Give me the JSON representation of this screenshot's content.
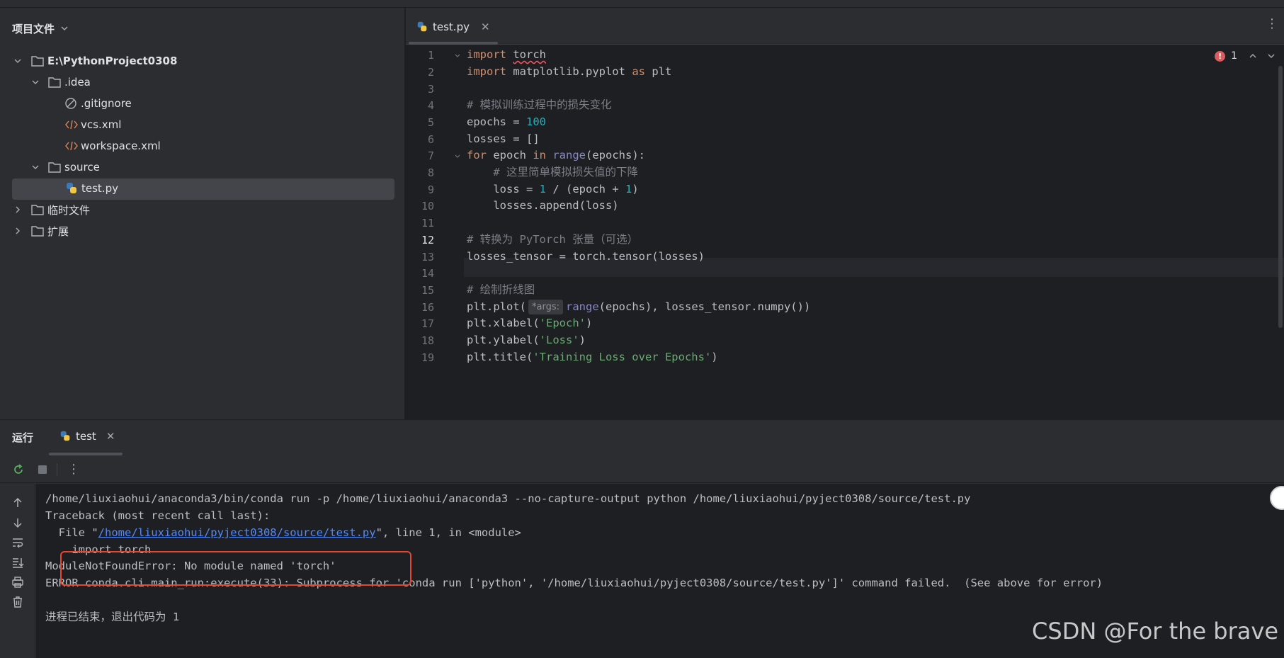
{
  "project": {
    "header": "项目文件",
    "items": [
      {
        "label": "E:\\PythonProject0308",
        "bold": true
      },
      {
        "label": ".idea"
      },
      {
        "label": ".gitignore"
      },
      {
        "label": "vcs.xml"
      },
      {
        "label": "workspace.xml"
      },
      {
        "label": "source"
      },
      {
        "label": "test.py"
      },
      {
        "label": "临时文件"
      },
      {
        "label": "扩展"
      }
    ]
  },
  "editor": {
    "tab_label": "test.py",
    "tab_close": "✕",
    "current_line": 12,
    "error_count": "1",
    "error_badge": "!",
    "line_numbers": [
      "1",
      "2",
      "3",
      "4",
      "5",
      "6",
      "7",
      "8",
      "9",
      "10",
      "11",
      "12",
      "13",
      "14",
      "15",
      "16",
      "17",
      "18",
      "19"
    ],
    "code": {
      "l1_kw": "import",
      "l1_rest": "torch",
      "l2_kw": "import",
      "l2_mod": " matplotlib.pyplot ",
      "l2_as": "as",
      "l2_alias": " plt",
      "l4": "# 模拟训练过程中的损失变化",
      "l5_a": "epochs = ",
      "l5_num": "100",
      "l6": "losses = []",
      "l7_for": "for",
      "l7_a": " epoch ",
      "l7_in": "in",
      "l7_range": " range",
      "l7_b": "(epochs):",
      "l8": "    # 这里简单模拟损失值的下降",
      "l9_a": "    loss = ",
      "l9_n1": "1",
      "l9_b": " / (epoch + ",
      "l9_n2": "1",
      "l9_c": ")",
      "l10": "    losses.append(loss)",
      "l12": "# 转换为 PyTorch 张量（可选）",
      "l13": "losses_tensor = torch.tensor(losses)",
      "l15": "# 绘制折线图",
      "l16_a": "plt.plot(",
      "l16_hint": "*args:",
      "l16_range": "range",
      "l16_b": "(epochs), losses_tensor.numpy())",
      "l17_a": "plt.xlabel(",
      "l17_s": "'Epoch'",
      "l17_b": ")",
      "l18_a": "plt.ylabel(",
      "l18_s": "'Loss'",
      "l18_b": ")",
      "l19_a": "plt.title(",
      "l19_s": "'Training Loss over Epochs'",
      "l19_b": ")"
    }
  },
  "run": {
    "title": "运行",
    "tab_label": "test",
    "tab_close": "✕",
    "console": {
      "l1": "/home/liuxiaohui/anaconda3/bin/conda run -p /home/liuxiaohui/anaconda3 --no-capture-output python /home/liuxiaohui/pyject0308/source/test.py",
      "l2": "Traceback (most recent call last):",
      "l3_a": "  File \"",
      "l3_link": "/home/liuxiaohui/pyject0308/source/test.py",
      "l3_b": "\", line 1, in <module>",
      "l4": "    import torch",
      "l5": "ModuleNotFoundError: No module named 'torch'",
      "l6": "ERROR conda.cli.main_run:execute(33): Subprocess for 'conda run ['python', '/home/liuxiaohui/pyject0308/source/test.py']' command failed.  (See above for error)",
      "l8": "进程已结束，退出代码为 1"
    }
  },
  "watermark": "CSDN @For the brave"
}
